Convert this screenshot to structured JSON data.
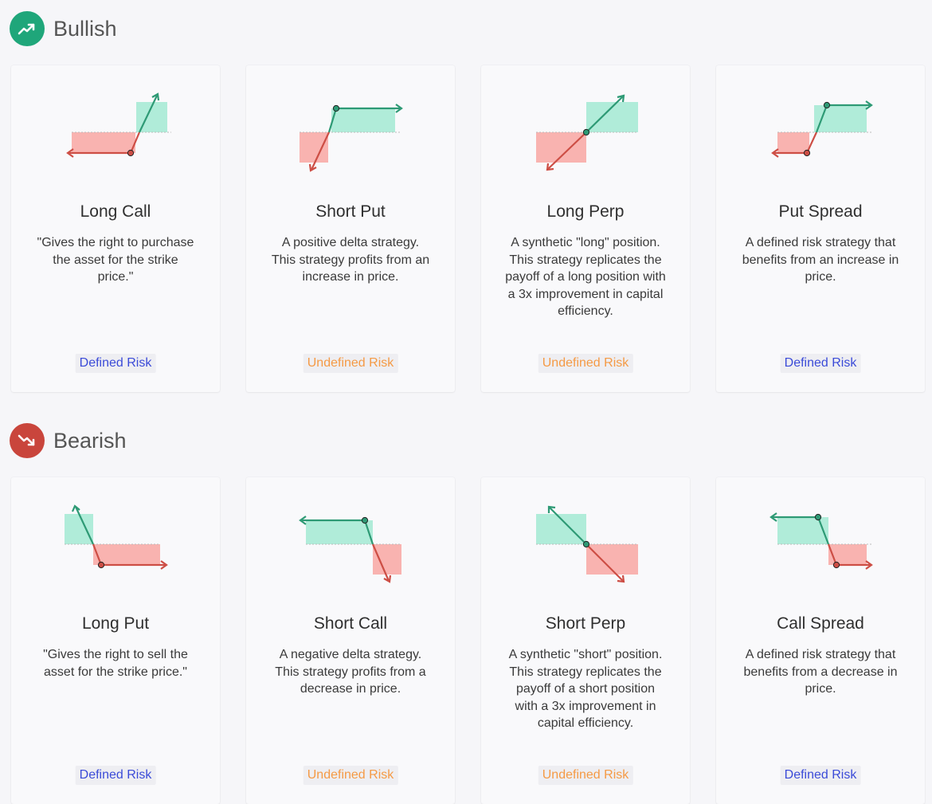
{
  "colors": {
    "bullish": "#1fa67a",
    "bearish": "#c9453c",
    "profit_fill": "#b0ecd9",
    "loss_fill": "#f9b3b0",
    "profit_line": "#2e9a75",
    "loss_line": "#cd4e45",
    "defined": "#3b4bd8",
    "undefined": "#f59a45"
  },
  "sections": [
    {
      "title": "Bullish",
      "icon": "trending-up-icon",
      "cards": [
        {
          "name": "Long Call",
          "desc": "\"Gives the right to purchase the asset for the strike price.\"",
          "risk": "Defined Risk",
          "risk_type": "defined"
        },
        {
          "name": "Short Put",
          "desc": "A positive delta strategy. This strategy profits from an increase in price.",
          "risk": "Undefined Risk",
          "risk_type": "undefined"
        },
        {
          "name": "Long Perp",
          "desc": "A synthetic \"long\" position. This strategy replicates the payoff of a long position with a 3x improvement in capital efficiency.",
          "risk": "Undefined Risk",
          "risk_type": "undefined"
        },
        {
          "name": "Put Spread",
          "desc": "A defined risk strategy that benefits from an increase in price.",
          "risk": "Defined Risk",
          "risk_type": "defined"
        }
      ]
    },
    {
      "title": "Bearish",
      "icon": "trending-down-icon",
      "cards": [
        {
          "name": "Long Put",
          "desc": "\"Gives the right to sell the asset for the strike price.\"",
          "risk": "Defined Risk",
          "risk_type": "defined"
        },
        {
          "name": "Short Call",
          "desc": "A negative delta strategy. This strategy profits from a decrease in price.",
          "risk": "Undefined Risk",
          "risk_type": "undefined"
        },
        {
          "name": "Short Perp",
          "desc": "A synthetic \"short\" position. This strategy replicates the payoff of a short position with a 3x improvement in capital efficiency.",
          "risk": "Undefined Risk",
          "risk_type": "undefined"
        },
        {
          "name": "Call Spread",
          "desc": "A defined risk strategy that benefits from a decrease in price.",
          "risk": "Defined Risk",
          "risk_type": "defined"
        }
      ]
    }
  ]
}
